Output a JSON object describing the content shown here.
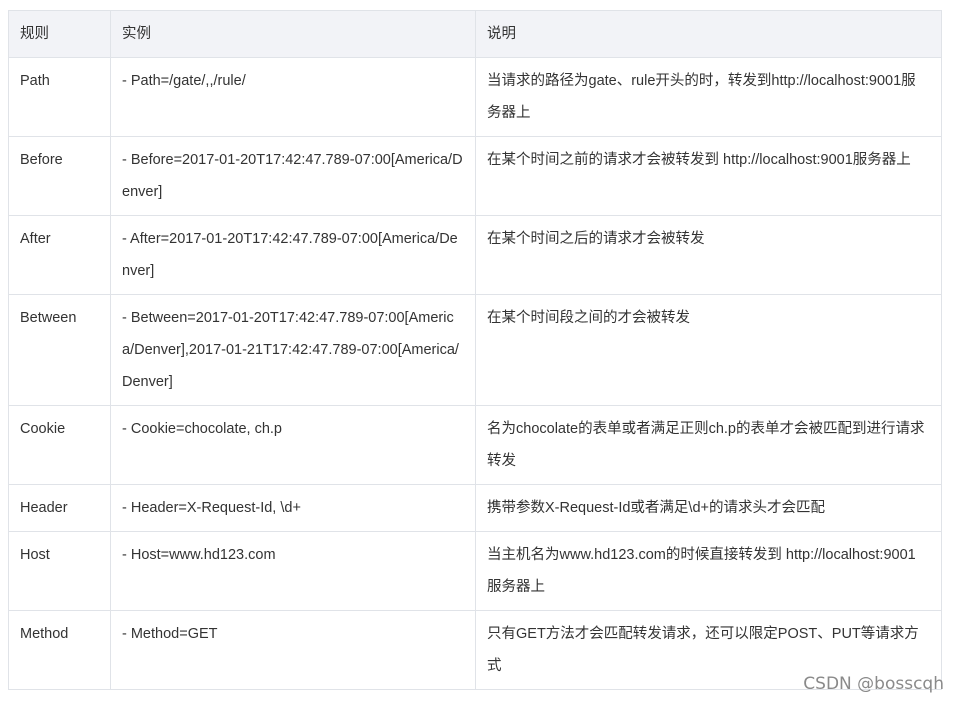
{
  "table": {
    "headers": [
      "规则",
      "实例",
      "说明"
    ],
    "rows": [
      {
        "rule": "Path",
        "example": "- Path=/gate/,,/rule/",
        "desc": "当请求的路径为gate、rule开头的时，转发到http://localhost:9001服务器上"
      },
      {
        "rule": "Before",
        "example": "- Before=2017-01-20T17:42:47.789-07:00[America/Denver]",
        "desc": "在某个时间之前的请求才会被转发到 http://localhost:9001服务器上"
      },
      {
        "rule": "After",
        "example": "- After=2017-01-20T17:42:47.789-07:00[America/Denver]",
        "desc": "在某个时间之后的请求才会被转发"
      },
      {
        "rule": "Between",
        "example": "- Between=2017-01-20T17:42:47.789-07:00[America/Denver],2017-01-21T17:42:47.789-07:00[America/Denver]",
        "desc": "在某个时间段之间的才会被转发"
      },
      {
        "rule": "Cookie",
        "example": "- Cookie=chocolate, ch.p",
        "desc": "名为chocolate的表单或者满足正则ch.p的表单才会被匹配到进行请求转发"
      },
      {
        "rule": "Header",
        "example": "- Header=X-Request-Id, \\d+",
        "desc": "携带参数X-Request-Id或者满足\\d+的请求头才会匹配"
      },
      {
        "rule": "Host",
        "example": "- Host=www.hd123.com",
        "desc": "当主机名为www.hd123.com的时候直接转发到 http://localhost:9001服务器上"
      },
      {
        "rule": "Method",
        "example": "- Method=GET",
        "desc": "只有GET方法才会匹配转发请求，还可以限定POST、PUT等请求方式"
      }
    ]
  },
  "watermark": "CSDN @bosscqh"
}
